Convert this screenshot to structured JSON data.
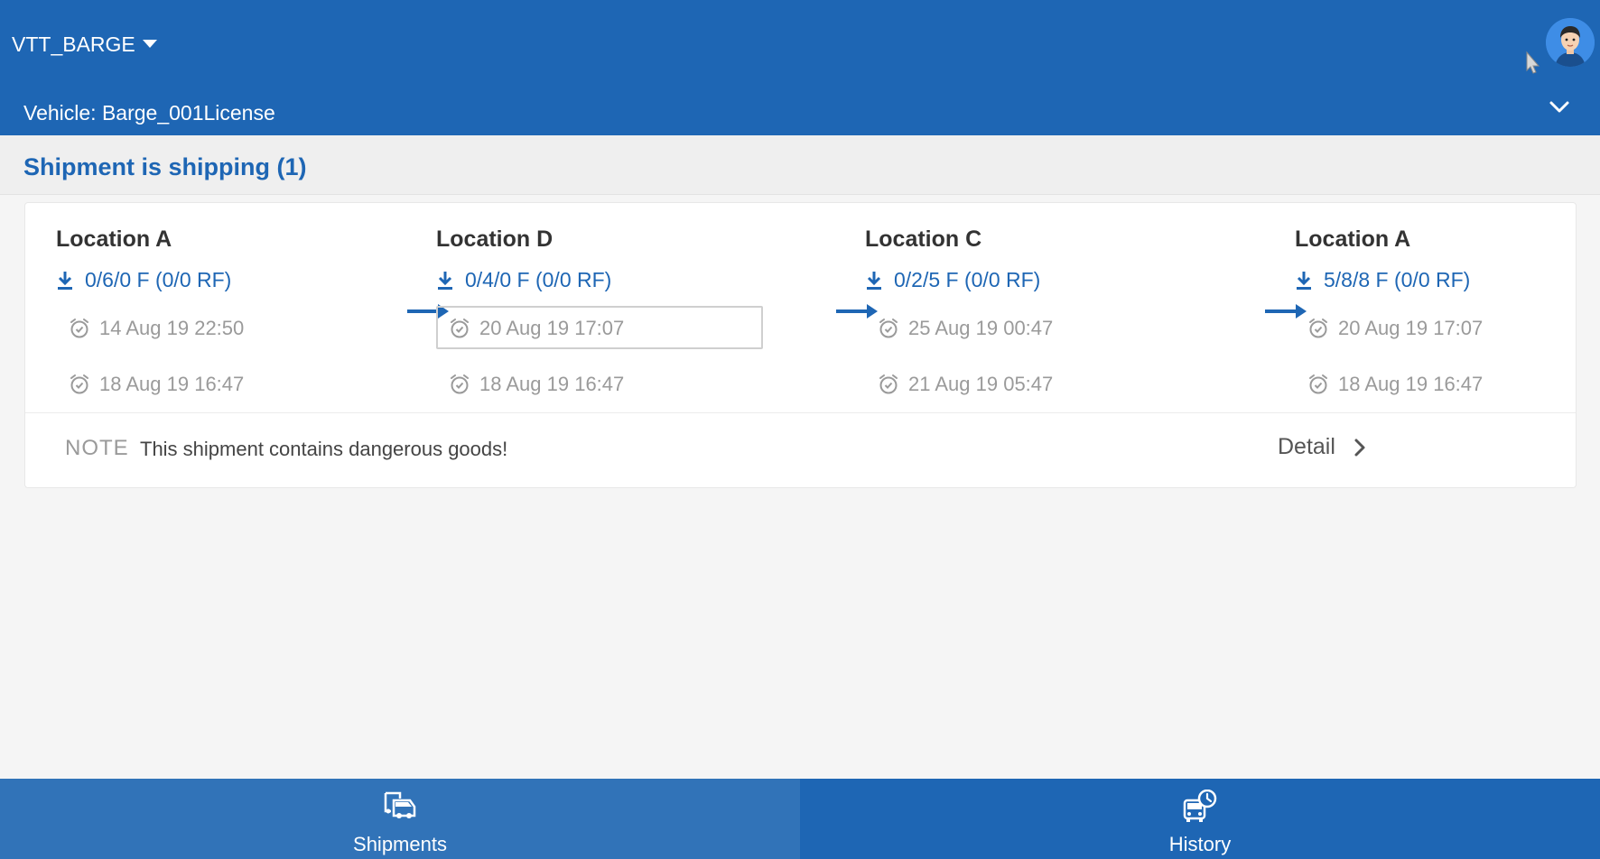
{
  "header": {
    "app_name": "VTT_BARGE",
    "vehicle_label": "Vehicle: Barge_001License"
  },
  "section": {
    "title": "Shipment is shipping (1)"
  },
  "shipment": {
    "stops": [
      {
        "name": "Location A",
        "cargo": "0/6/0 F (0/0 RF)",
        "time1": "14 Aug 19 22:50",
        "time2": "18 Aug 19 16:47"
      },
      {
        "name": "Location D",
        "cargo": "0/4/0 F (0/0 RF)",
        "time1": "20 Aug 19 17:07",
        "time2": "18 Aug 19 16:47"
      },
      {
        "name": "Location C",
        "cargo": "0/2/5 F (0/0 RF)",
        "time1": "25 Aug 19 00:47",
        "time2": "21 Aug 19 05:47"
      },
      {
        "name": "Location A",
        "cargo": "5/8/8 F (0/0 RF)",
        "time1": "20 Aug 19 17:07",
        "time2": "18 Aug 19 16:47"
      }
    ],
    "note_label": "NOTE",
    "note_text": "This shipment contains dangerous goods!",
    "detail_label": "Detail"
  },
  "nav": {
    "tabs": [
      {
        "label": "Shipments",
        "icon": "truck-icon",
        "active": true
      },
      {
        "label": "History",
        "icon": "truck-clock-icon",
        "active": false
      }
    ]
  },
  "colors": {
    "primary": "#1e66b4",
    "nav_active": "#3173b8",
    "muted_text": "#9a9a9a"
  }
}
